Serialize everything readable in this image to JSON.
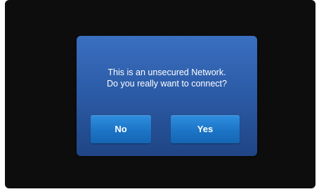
{
  "dialog": {
    "message_line1": "This is an unsecured Network.",
    "message_line2": "Do you really want to connect?",
    "no_label": "No",
    "yes_label": "Yes"
  },
  "colors": {
    "screen_bg": "#0d0d0d",
    "dialog_bg": "#2c5ca8",
    "button_bg": "#1c74c6"
  }
}
